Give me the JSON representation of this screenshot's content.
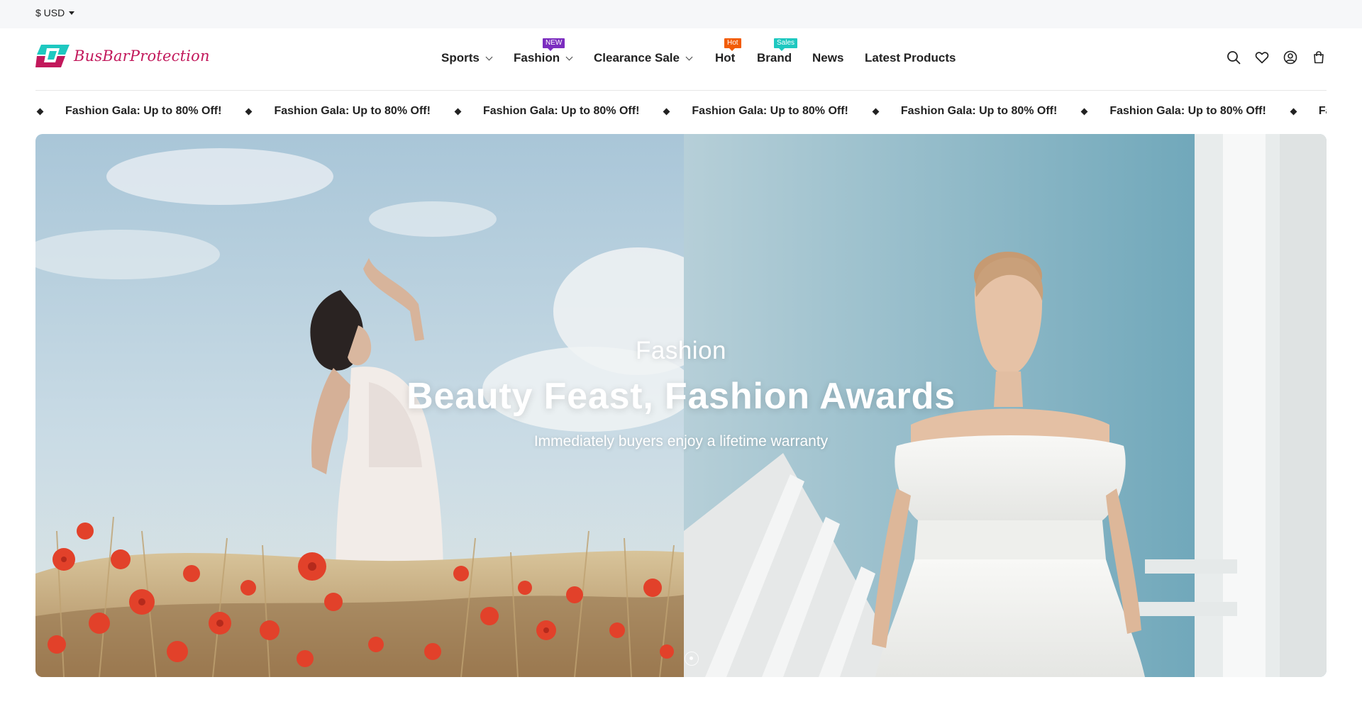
{
  "topbar": {
    "currency": "$ USD"
  },
  "brand": {
    "name": "BusBarProtection",
    "primary": "#c2185b",
    "accent": "#1ec8c0"
  },
  "nav": {
    "items": [
      {
        "label": "Sports",
        "dropdown": true
      },
      {
        "label": "Fashion",
        "dropdown": true,
        "badge": "NEW",
        "badge_color": "#7b2cbf"
      },
      {
        "label": "Clearance Sale",
        "dropdown": true
      },
      {
        "label": "Hot",
        "dropdown": false,
        "badge": "Hot",
        "badge_color": "#f25c05"
      },
      {
        "label": "Brand",
        "dropdown": false,
        "badge": "Sales",
        "badge_color": "#1ec8c0"
      },
      {
        "label": "News",
        "dropdown": false
      },
      {
        "label": "Latest Products",
        "dropdown": false
      }
    ]
  },
  "header_icons": [
    "search-icon",
    "heart-icon",
    "user-icon",
    "cart-icon"
  ],
  "marquee": {
    "text": "Fashion Gala: Up to 80% Off!"
  },
  "hero": {
    "subtitle": "Fashion",
    "title": "Beauty Feast, Fashion Awards",
    "description": "Immediately buyers enjoy a lifetime warranty"
  }
}
